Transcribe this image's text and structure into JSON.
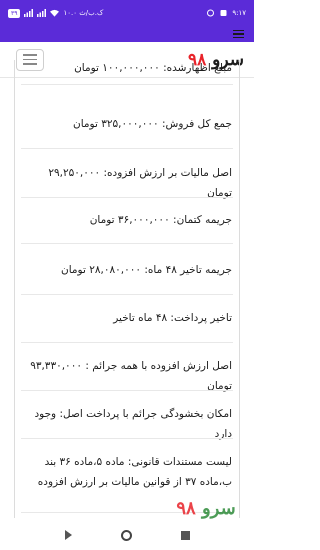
{
  "status_bar": {
    "time": "۹:۱۷",
    "speed": "۱۰.۰ ک.ب/ث",
    "battery": "۳۹"
  },
  "header": {
    "logo_text": "سرو",
    "logo_number": "۹۸"
  },
  "items": [
    "مبلغ اظهارشده: ۱۰۰,۰۰۰,۰۰۰ تومان",
    "جمع کل فروش: ۳۲۵,۰۰۰,۰۰۰ تومان",
    "اصل مالیات بر ارزش افزوده: ۲۹,۲۵۰,۰۰۰ تومان",
    "جریمه کتمان: ۳۶,۰۰۰,۰۰۰ تومان",
    "جریمه تاخیر ۴۸ ماه: ۲۸,۰۸۰,۰۰۰ تومان",
    "تاخیر پرداخت: ۴۸ ماه تاخیر",
    "اصل ارزش افزوده با همه جرائم : ۹۳,۳۳۰,۰۰۰ تومان",
    "امکان بخشودگی جرائم با پرداخت اصل: وجود دارد",
    "لیست مستندات قانونی: ماده ۵،ماده ۳۶ بند ب،ماده ۳۷ از قوانین مالیات بر ارزش افزوده"
  ],
  "watermark": {
    "text": "سرو",
    "number": "۹۸"
  }
}
